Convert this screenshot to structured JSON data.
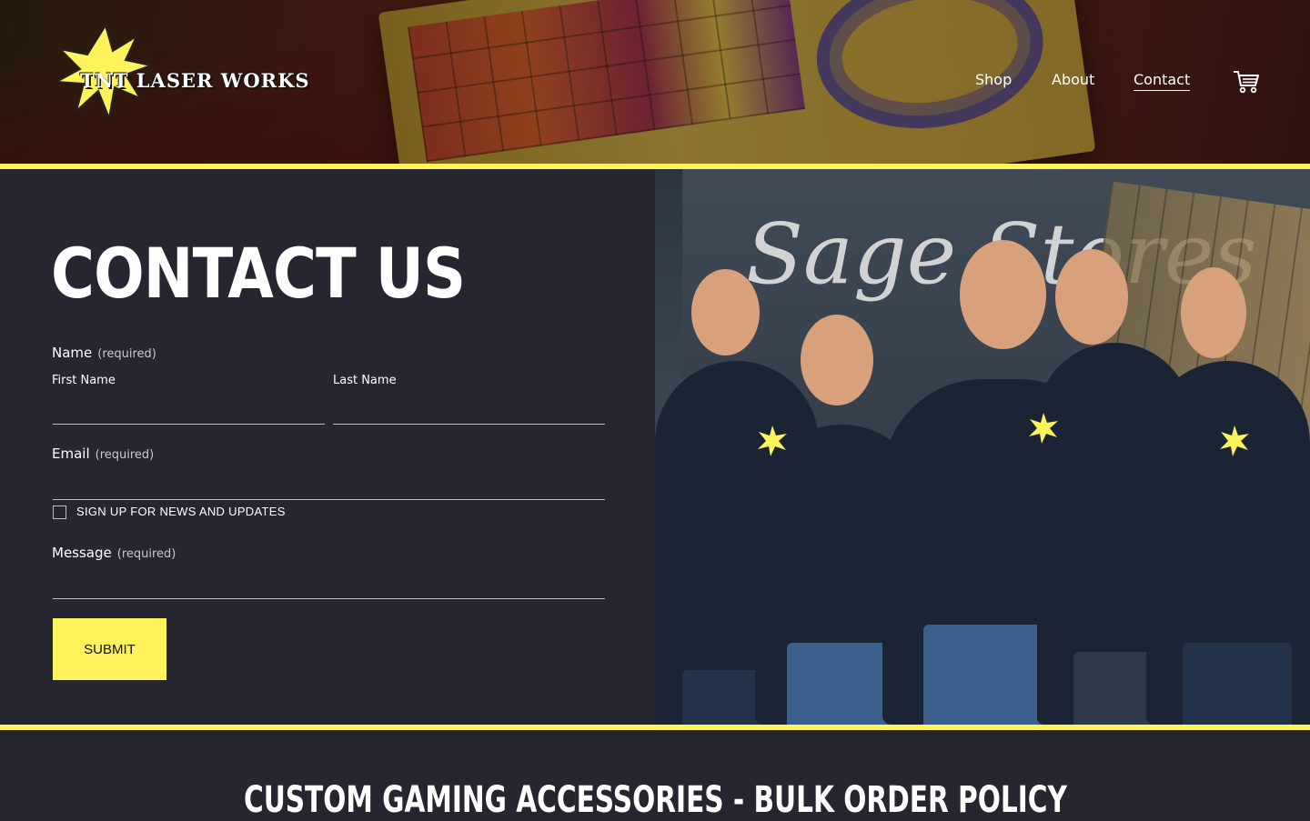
{
  "header": {
    "logo_text": "TNT LASER WORKS",
    "nav": [
      {
        "label": "Shop"
      },
      {
        "label": "About"
      },
      {
        "label": "Contact",
        "active": true
      }
    ],
    "cart_icon": "cart-icon"
  },
  "contact": {
    "title": "CONTACT US",
    "name": {
      "label": "Name",
      "required": "(required)",
      "first_label": "First Name",
      "last_label": "Last Name",
      "first_value": "",
      "last_value": ""
    },
    "email": {
      "label": "Email",
      "required": "(required)",
      "value": ""
    },
    "signup": {
      "label": "SIGN UP FOR NEWS AND UPDATES",
      "checked": false
    },
    "message": {
      "label": "Message",
      "required": "(required)",
      "value": ""
    },
    "submit_label": "SUBMIT"
  },
  "photo": {
    "banner_text": "Sage Stores"
  },
  "bottom": {
    "title": "CUSTOM GAMING ACCESSORIES - BULK ORDER POLICY"
  },
  "colors": {
    "accent": "#fff35c",
    "background": "#262630"
  }
}
